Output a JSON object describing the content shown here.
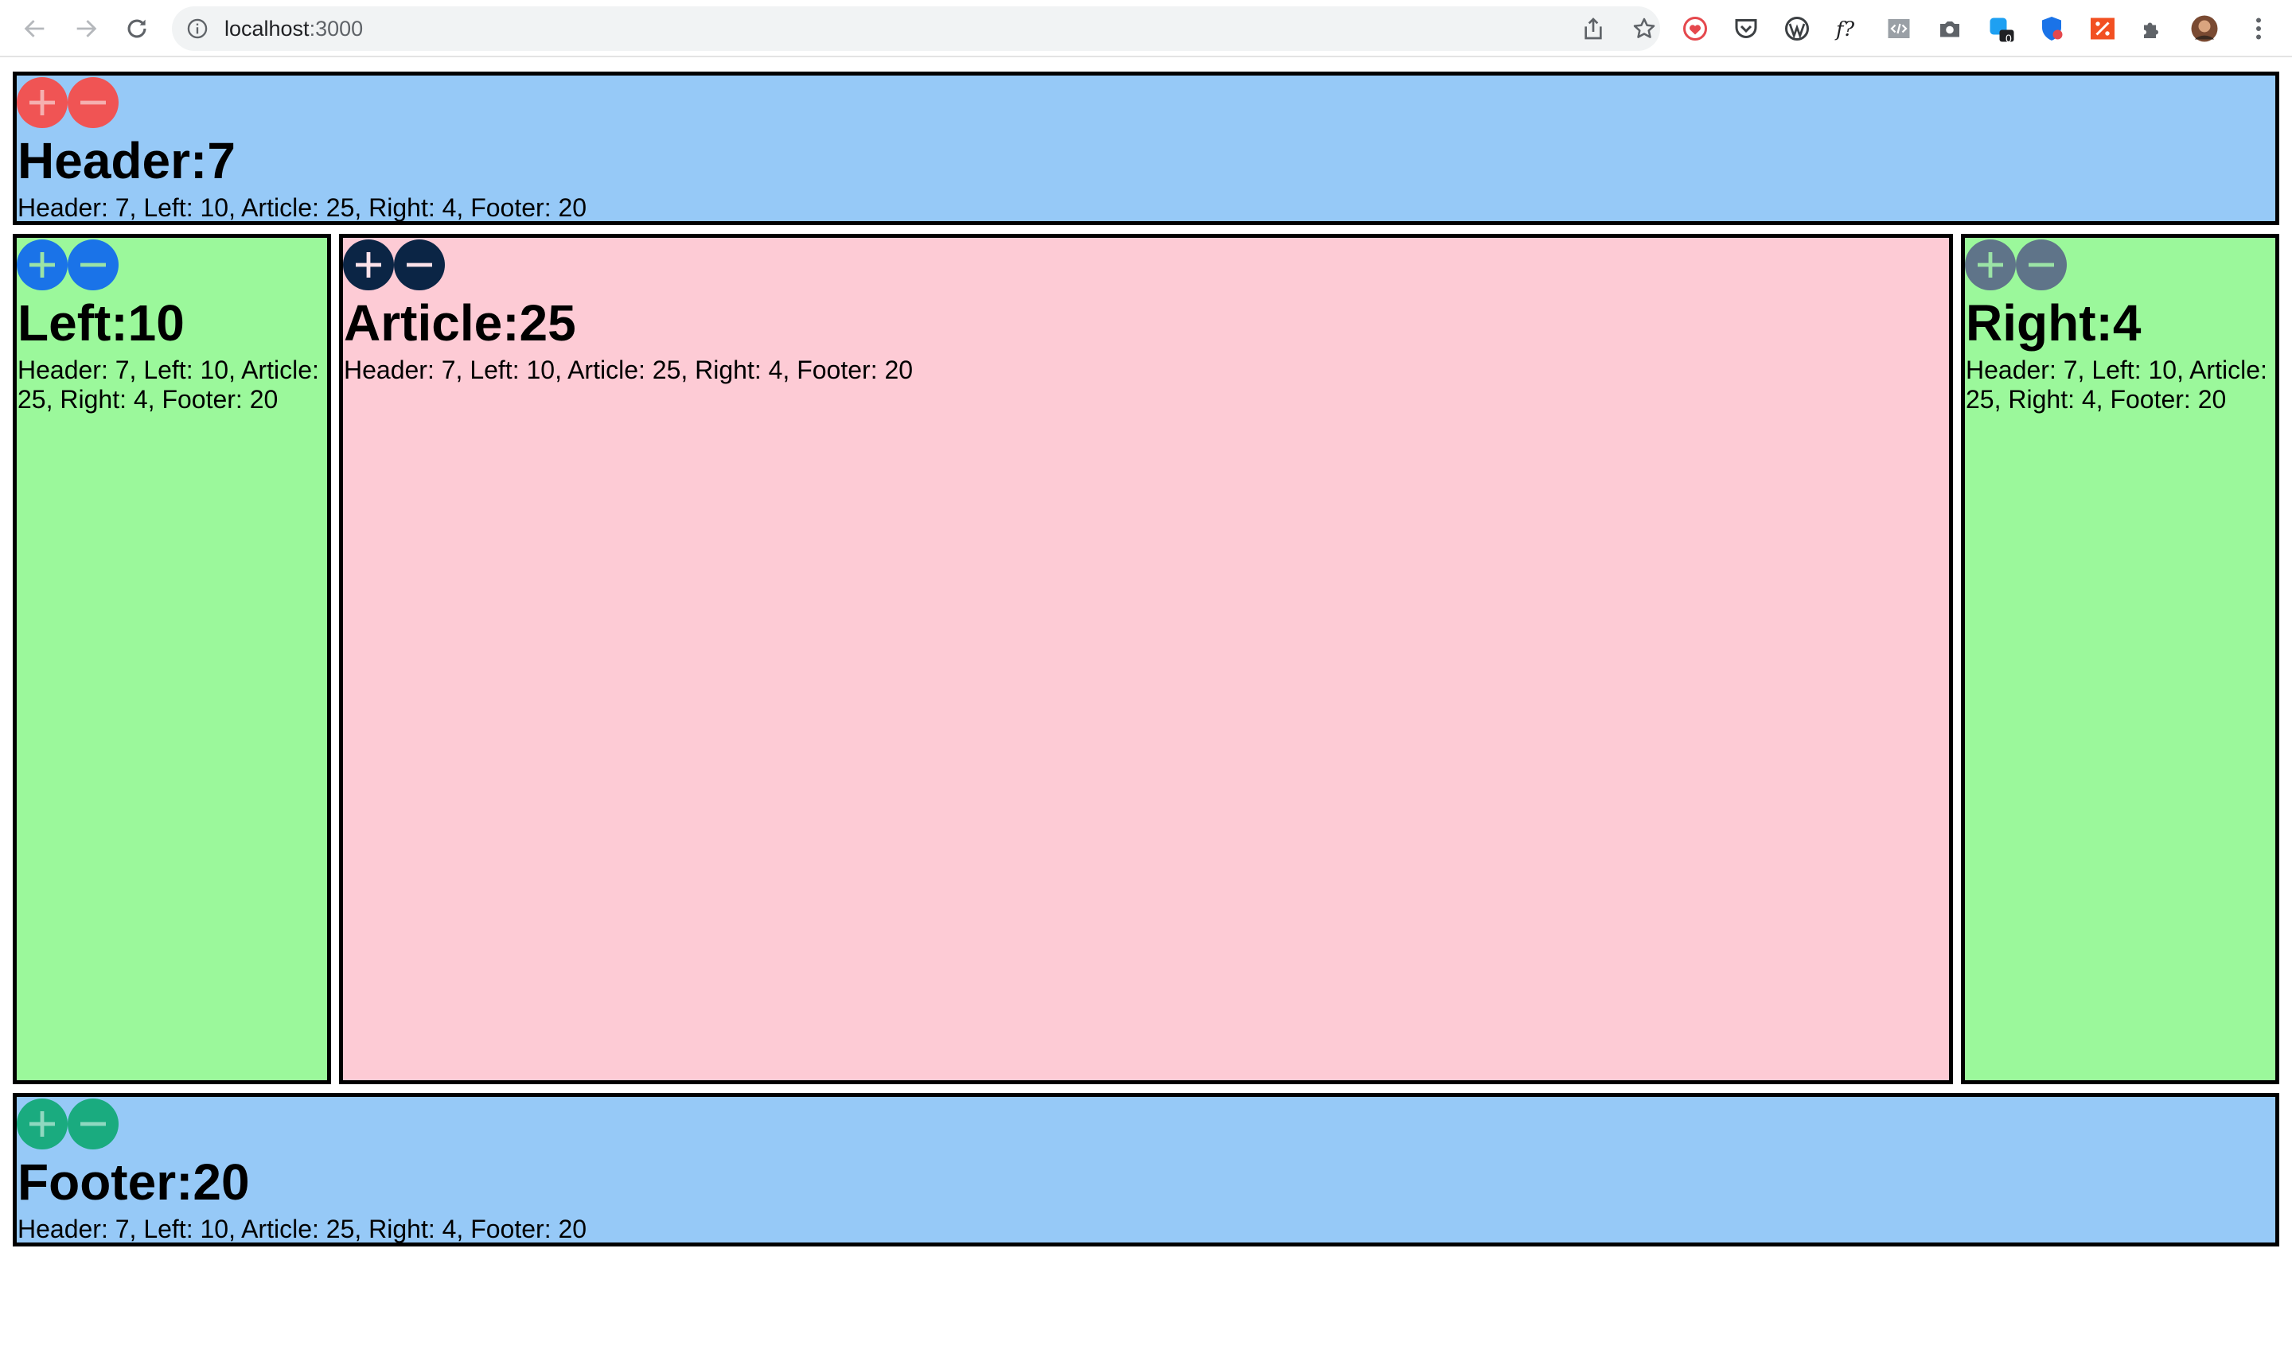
{
  "browser": {
    "url_host": "localhost",
    "url_port": ":3000",
    "extension_badge": "0"
  },
  "panels": {
    "header": {
      "title": "Header:7",
      "summary": "Header: 7, Left: 10, Article: 25, Right: 4, Footer: 20",
      "accent": "#f05454",
      "bg": "#96c9f7"
    },
    "left": {
      "title": "Left:10",
      "summary": "Header: 7, Left: 10, Article: 25, Right: 4, Footer: 20",
      "accent": "#1a73e8",
      "bg": "#9bf89b"
    },
    "article": {
      "title": "Article:25",
      "summary": "Header: 7, Left: 10, Article: 25, Right: 4, Footer: 20",
      "accent": "#0b2545",
      "bg": "#fdcbd5"
    },
    "right": {
      "title": "Right:4",
      "summary": "Header: 7, Left: 10, Article: 25, Right: 4, Footer: 20",
      "accent": "#5f7489",
      "bg": "#9bf89b"
    },
    "footer": {
      "title": "Footer:20",
      "summary": "Header: 7, Left: 10, Article: 25, Right: 4, Footer: 20",
      "accent": "#1aab7f",
      "bg": "#96c9f7"
    }
  }
}
